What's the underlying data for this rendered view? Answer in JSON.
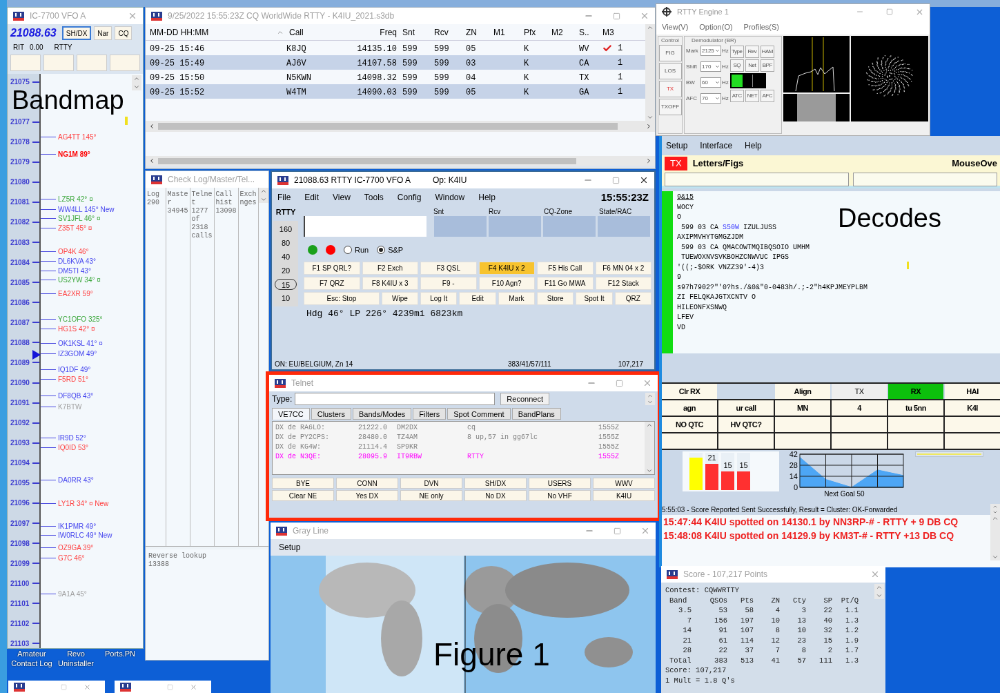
{
  "bandmap": {
    "title": "IC-7700 VFO A",
    "frequency": "21088.63",
    "buttons": [
      "SH/DX",
      "Nar",
      "CQ"
    ],
    "rit_label": "RIT",
    "rit": "0.00",
    "mode": "RTTY",
    "overlay_label": "Bandmap",
    "ticks": [
      "21075",
      "21077",
      "21078",
      "21079",
      "21080",
      "21081",
      "21082",
      "21083",
      "21084",
      "21085",
      "21086",
      "21087",
      "21088",
      "21089",
      "21090",
      "21091",
      "21092",
      "21093",
      "21094",
      "21095",
      "21096",
      "21097",
      "21098",
      "21099",
      "21100",
      "21101",
      "21102",
      "21103"
    ],
    "spots": [
      {
        "text": "AG4TT 145°",
        "color": "#ff4040",
        "bold": false
      },
      {
        "text": "NG1M 89°",
        "color": "#ff0000",
        "bold": true
      },
      {
        "text": "LZ5R 42° ¤",
        "color": "#3aa63a",
        "bold": false
      },
      {
        "text": "WW4LL 145° New",
        "color": "#4444ee",
        "bold": false
      },
      {
        "text": "SV1JFL 46° ¤",
        "color": "#3aa63a",
        "bold": false
      },
      {
        "text": "Z35T 45° ¤",
        "color": "#ff4040",
        "bold": false
      },
      {
        "text": "OP4K 46°",
        "color": "#ff4040",
        "bold": false
      },
      {
        "text": "DL6KVA 43°",
        "color": "#4444ee",
        "bold": false
      },
      {
        "text": "DM5TI 43°",
        "color": "#4444ee",
        "bold": false
      },
      {
        "text": "US2YW 34° ¤",
        "color": "#3aa63a",
        "bold": false
      },
      {
        "text": "EA2XR 59°",
        "color": "#ff4040",
        "bold": false
      },
      {
        "text": "YC1OFO 325°",
        "color": "#3aa63a",
        "bold": false
      },
      {
        "text": "HG1S 42° ¤",
        "color": "#ff4040",
        "bold": false
      },
      {
        "text": "OK1KSL 41° ¤",
        "color": "#4444ee",
        "bold": false
      },
      {
        "text": "IZ3GOM 49°",
        "color": "#4444ee",
        "bold": false
      },
      {
        "text": "IQ1DF 49°",
        "color": "#4444ee",
        "bold": false
      },
      {
        "text": "F5RD 51°",
        "color": "#ff4040",
        "bold": false
      },
      {
        "text": "DF8QB 43°",
        "color": "#4444ee",
        "bold": false
      },
      {
        "text": "K7BTW",
        "color": "#a0a0a0",
        "bold": false
      },
      {
        "text": "IR9D 52°",
        "color": "#4444ee",
        "bold": false
      },
      {
        "text": "IQ0ID 53°",
        "color": "#ff4040",
        "bold": false
      },
      {
        "text": "DA0RR 43°",
        "color": "#4444ee",
        "bold": false
      },
      {
        "text": "LY1R 34° ¤ New",
        "color": "#ff4040",
        "bold": false
      },
      {
        "text": "IK1PMR 49°",
        "color": "#4444ee",
        "bold": false
      },
      {
        "text": "IW0RLC 49° New",
        "color": "#4444ee",
        "bold": false
      },
      {
        "text": "OZ9GA 39°",
        "color": "#ff4040",
        "bold": false
      },
      {
        "text": "G7C 46°",
        "color": "#ff4040",
        "bold": false
      },
      {
        "text": "9A1A 45°",
        "color": "#a0a0a0",
        "bold": false
      }
    ]
  },
  "desktop_icons": [
    "Amateur Contact Log",
    "Revo Uninstaller",
    "Ports.PN"
  ],
  "log": {
    "title": "9/25/2022 15:55:23Z CQ WorldWide RTTY - K4IU_2021.s3db",
    "columns": [
      "MM-DD HH:MM",
      "Call",
      "Freq",
      "Snt",
      "Rcv",
      "ZN",
      "M1",
      "Pfx",
      "M2",
      "S..",
      "M3"
    ],
    "rows": [
      {
        "time": "09-25 15:46",
        "call": "K8JQ",
        "freq": "14135.10",
        "snt": "599",
        "rcv": "599",
        "zn": "05",
        "pfx": "K",
        "state": "WV",
        "checked": true,
        "column_12": "1"
      },
      {
        "time": "09-25 15:49",
        "call": "AJ6V",
        "freq": "14107.58",
        "snt": "599",
        "rcv": "599",
        "zn": "03",
        "pfx": "K",
        "state": "CA",
        "checked": false,
        "column_12": "1"
      },
      {
        "time": "09-25 15:50",
        "call": "N5KWN",
        "freq": "14098.32",
        "snt": "599",
        "rcv": "599",
        "zn": "04",
        "pfx": "K",
        "state": "TX",
        "checked": false,
        "column_12": "1"
      },
      {
        "time": "09-25 15:52",
        "call": "W4TM",
        "freq": "14090.03",
        "snt": "599",
        "rcv": "599",
        "zn": "05",
        "pfx": "K",
        "state": "GA",
        "checked": false,
        "column_12": "1"
      }
    ]
  },
  "checklog": {
    "title": "Check Log/Master/Tel...",
    "columns": [
      [
        "Log",
        "290"
      ],
      [
        "Maste",
        "r",
        "34945"
      ],
      [
        "Telne",
        "t",
        "1277",
        "of",
        "2318",
        "calls"
      ],
      [
        "Call",
        "hist",
        "13098"
      ],
      [
        "Exch",
        "nges"
      ]
    ],
    "reverse_lookup": [
      "Reverse lookup",
      "13388"
    ]
  },
  "entry": {
    "title": "21088.63 RTTY IC-7700 VFO A",
    "operator": "Op: K4IU",
    "menu": [
      "File",
      "Edit",
      "View",
      "Tools",
      "Config",
      "Window",
      "Help"
    ],
    "clock": "15:55:23Z",
    "mode": "RTTY",
    "bands": [
      {
        "label": "160",
        "selected": false
      },
      {
        "label": "80",
        "selected": false
      },
      {
        "label": "40",
        "selected": false
      },
      {
        "label": "20",
        "selected": false
      },
      {
        "label": "15",
        "selected": true
      },
      {
        "label": "10",
        "selected": false
      }
    ],
    "exchange_labels": [
      "Snt",
      "Rcv",
      "CQ-Zone",
      "State/RAC"
    ],
    "status_dots": [
      {
        "color": "#1aa01a"
      },
      {
        "color": "#ff0000"
      }
    ],
    "radios": [
      {
        "label": "Run",
        "selected": false
      },
      {
        "label": "S&P",
        "selected": true
      }
    ],
    "function_keys": [
      [
        {
          "label": "F1 SP QRL?",
          "highlighted": false
        },
        {
          "label": "F2 Exch",
          "highlighted": false
        },
        {
          "label": "F3 QSL",
          "highlighted": false
        },
        {
          "label": "F4 K4IU x 2",
          "highlighted": true
        },
        {
          "label": "F5 His Call",
          "highlighted": false
        },
        {
          "label": "F6 MN 04 x 2",
          "highlighted": false
        }
      ],
      [
        {
          "label": "F7 QRZ",
          "highlighted": false
        },
        {
          "label": "F8 K4IU x 3",
          "highlighted": false
        },
        {
          "label": "F9 -",
          "highlighted": false
        },
        {
          "label": "F10 Agn?",
          "highlighted": false
        },
        {
          "label": "F11 Go MWA",
          "highlighted": false
        },
        {
          "label": "F12 Stack",
          "highlighted": false
        }
      ],
      [
        {
          "label": "Esc: Stop",
          "highlighted": false
        },
        {
          "label": "Wipe",
          "highlighted": false
        },
        {
          "label": "Log It",
          "highlighted": false
        },
        {
          "label": "Edit",
          "highlighted": false
        },
        {
          "label": "Mark",
          "highlighted": false
        },
        {
          "label": "Store",
          "highlighted": false
        },
        {
          "label": "Spot It",
          "highlighted": false
        },
        {
          "label": "QRZ",
          "highlighted": false
        }
      ]
    ],
    "heading": "Hdg 46° LP 226° 4239mi 6823km",
    "status": [
      "ON: EU/BELGIUM, Zn 14",
      "383/41/57/111",
      "107,217"
    ]
  },
  "telnet": {
    "title": "Telnet",
    "highlight_frame": true,
    "type_label": "Type:",
    "reconnect": "Reconnect",
    "tabs": [
      {
        "label": "VE7CC",
        "selected": true
      },
      {
        "label": "Clusters",
        "selected": false
      },
      {
        "label": "Bands/Modes",
        "selected": false
      },
      {
        "label": "Filters",
        "selected": false
      },
      {
        "label": "Spot Comment",
        "selected": false
      },
      {
        "label": "BandPlans",
        "selected": false
      }
    ],
    "spots": [
      {
        "spotter": "DX de RA6LO:",
        "freq": "21222.0",
        "call": "DM2DX",
        "comment": "cq",
        "time": "1555Z",
        "color": "#808080"
      },
      {
        "spotter": "DX de PY2CPS:",
        "freq": "28480.0",
        "call": "TZ4AM",
        "comment": "8 up,57 in gg67lc",
        "time": "1555Z",
        "color": "#808080"
      },
      {
        "spotter": "DX de KG4W:",
        "freq": "21114.4",
        "call": "SP9KR",
        "time": "1555Z",
        "color": "#808080"
      },
      {
        "spotter": "DX de N3QE:",
        "freq": "28095.9",
        "call": "IT9RBW",
        "comment": "RTTY",
        "time": "1555Z",
        "color": "#ff00ff"
      }
    ],
    "buttons": [
      [
        "BYE",
        "CONN",
        "DVN",
        "SH/DX",
        "USERS",
        "WWV"
      ],
      [
        "Clear NE",
        "Yes DX",
        "NE only",
        "No DX",
        "No VHF",
        "K4IU"
      ]
    ]
  },
  "grayline": {
    "title": "Gray Line",
    "menu": [
      "Setup"
    ],
    "overlay_label": "Figure 1"
  },
  "rtty_engine": {
    "title": "RTTY Engine 1",
    "menu": [
      "View(V)",
      "Option(O)",
      "Profiles(S)"
    ],
    "groups": [
      "Control",
      "Demodulator (BR)"
    ],
    "side_buttons": [
      {
        "label": "FIG",
        "kind": "normal"
      },
      {
        "label": "LOS",
        "kind": "normal"
      },
      {
        "label": "TX",
        "kind": "alert"
      },
      {
        "label": "TXOFF",
        "kind": "normal"
      }
    ],
    "settings": [
      {
        "label": "Mark",
        "value": "2125",
        "unit": "Hz"
      },
      {
        "label": "Shift",
        "value": "170",
        "unit": "Hz"
      },
      {
        "label": "BW",
        "value": "60",
        "unit": "Hz"
      },
      {
        "label": "AFC",
        "value": "70",
        "unit": "Hz"
      }
    ],
    "toggles": [
      [
        "Type",
        "Rev",
        "HAM"
      ],
      [
        "SQ",
        "Net",
        "BPF"
      ],
      [
        "ATC",
        "NET",
        "AFC"
      ]
    ]
  },
  "mmtty": {
    "menu": [
      "Setup",
      "Interface",
      "Help"
    ],
    "tx_badge": "TX",
    "letters_figs": "Letters/Figs",
    "mouseover": "MouseOve",
    "overlay_label": "Decodes",
    "decodes": [
      {
        "parts": [
          {
            "text": "9&15"
          }
        ],
        "underlined": true
      },
      {
        "parts": [
          {
            "text": "WOCY"
          }
        ],
        "underlined": false
      },
      {
        "parts": [
          {
            "text": "O"
          }
        ],
        "underlined": false
      },
      {
        "parts": [
          {
            "text": " 599 03 CA "
          },
          {
            "text": "S50W",
            "color": "#3a3aff"
          },
          {
            "text": " IZULJUSS"
          }
        ],
        "underlined": false
      },
      {
        "parts": [
          {
            "text": "AXIPMVHYTGMGZJDM"
          }
        ],
        "underlined": false
      },
      {
        "parts": [
          {
            "text": " 599 03 CA QMACOWTMQIBQSOIO UMHM"
          }
        ],
        "underlined": false
      },
      {
        "parts": [
          {
            "text": " TUEWOXNVSVKBOHZCNWVUC IPGS"
          }
        ],
        "underlined": false
      },
      {
        "parts": [
          {
            "text": "'((;-$ORK VNZZ39'-4)3"
          }
        ],
        "underlined": false
      },
      {
        "parts": [
          {
            "text": "9"
          }
        ],
        "underlined": false
      },
      {
        "parts": [
          {
            "text": "s97h7902?\"'0?hs./&0&\"0-0483h/.;-2\"h4KPJMEYPLBM"
          }
        ],
        "underlined": false
      },
      {
        "parts": [
          {
            "text": "ZI FELQKAJGTXCNTV O"
          }
        ],
        "underlined": false
      },
      {
        "parts": [
          {
            "text": "HILEONFXSNWQ"
          }
        ],
        "underlined": false
      },
      {
        "parts": [
          {
            "text": "LFEV"
          }
        ],
        "underlined": false
      },
      {
        "parts": [
          {
            "text": "VD"
          }
        ],
        "underlined": false
      }
    ],
    "macros": [
      [
        {
          "kind": "button",
          "label": "Clr RX"
        },
        {
          "kind": "gap"
        },
        {
          "kind": "button",
          "label": "Align"
        },
        {
          "kind": "off",
          "label": "TX"
        },
        {
          "kind": "on",
          "label": "RX"
        },
        {
          "kind": "button",
          "label": "HAI"
        }
      ],
      [
        {
          "kind": "button",
          "label": "agn"
        },
        {
          "kind": "button",
          "label": "ur call"
        },
        {
          "kind": "button",
          "label": "MN"
        },
        {
          "kind": "button",
          "label": "4"
        },
        {
          "kind": "button",
          "label": "tu 5nn"
        },
        {
          "kind": "button",
          "label": "K4I"
        }
      ],
      [
        {
          "kind": "button",
          "label": "NO QTC"
        },
        {
          "kind": "button",
          "label": "HV QTC?"
        },
        {
          "kind": "blank"
        },
        {
          "kind": "blank"
        },
        {
          "kind": "blank"
        },
        {
          "kind": "blank"
        }
      ],
      [
        {
          "kind": "blank"
        },
        {
          "kind": "blank"
        },
        {
          "kind": "blank"
        },
        {
          "kind": "blank"
        },
        {
          "kind": "blank"
        },
        {
          "kind": "blank"
        }
      ]
    ],
    "rate_chart": {
      "bars": [
        {
          "color": "#ffff00",
          "level": 0.87
        },
        {
          "color": "#ff3030",
          "level": 0.7,
          "label": "21"
        },
        {
          "color": "#ff3030",
          "level": 0.5,
          "label": "15"
        },
        {
          "color": "#ff3030",
          "level": 0.5,
          "label": "15"
        }
      ]
    },
    "goal_chart": {
      "chart_data": {
        "type": "area",
        "xlabel": "Next Goal 50",
        "categories": [
          null,
          null,
          null,
          null,
          null
        ],
        "grid": true,
        "series": [
          {
            "color": "#4da6f5",
            "values": [
              38,
              10,
              0,
              22,
              15
            ]
          }
        ],
        "ylim": [
          0,
          42
        ],
        "yticks": [
          0,
          14,
          28,
          42
        ]
      }
    },
    "goal_bar": {
      "level": 1
    },
    "status_line": "5:55:03 - Score Reported Sent Successfully, Result = Cluster: OK-Forwarded",
    "alerts": [
      "15:47:44 K4IU spotted on 14130.1 by NN3RP-# - RTTY + 9 DB CQ",
      "15:48:08 K4IU spotted on 14129.9 by KM3T-# - RTTY +13 DB CQ"
    ]
  },
  "score": {
    "title": "Score - 107,217 Points",
    "contest": "Contest: CQWWRTTY",
    "columns": [
      "Band",
      "QSOs",
      "Pts",
      "ZN",
      "Cty",
      "SP",
      "Pt/Q"
    ],
    "rows": [
      [
        "3.5",
        "53",
        "58",
        "4",
        "3",
        "22",
        "1.1"
      ],
      [
        "7",
        "156",
        "197",
        "10",
        "13",
        "40",
        "1.3"
      ],
      [
        "14",
        "91",
        "107",
        "8",
        "10",
        "32",
        "1.2"
      ],
      [
        "21",
        "61",
        "114",
        "12",
        "23",
        "15",
        "1.9"
      ],
      [
        "28",
        "22",
        "37",
        "7",
        "8",
        "2",
        "1.7"
      ],
      [
        "Total",
        "383",
        "513",
        "41",
        "57",
        "111",
        "1.3"
      ]
    ],
    "score_line": "Score: 107,217",
    "mult_line": "1 Mult = 1.8 Q's"
  }
}
